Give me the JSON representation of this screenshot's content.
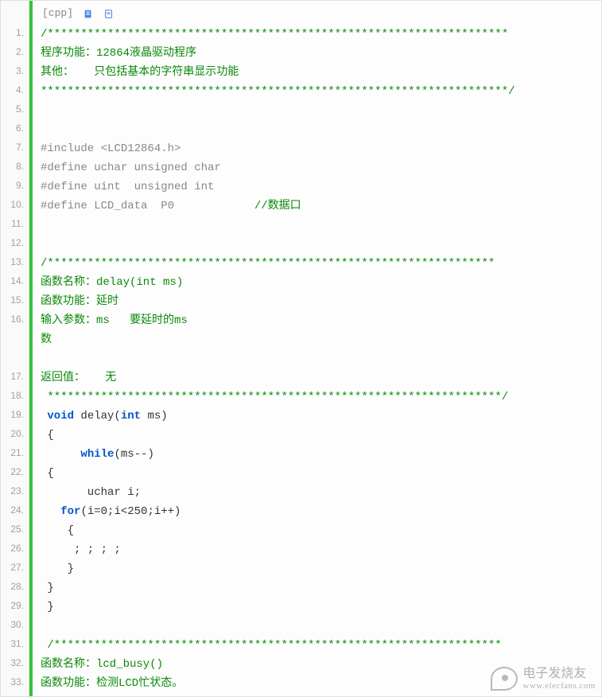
{
  "toolbar": {
    "lang": "[cpp]",
    "icons": [
      "copy-icon",
      "view-icon"
    ]
  },
  "lines": [
    {
      "n": "1.",
      "fragments": [
        {
          "cls": "comment",
          "t": "/*********************************************************************"
        }
      ]
    },
    {
      "n": "2.",
      "fragments": [
        {
          "cls": "comment",
          "t": "程序功能：12864液晶驱动程序"
        }
      ]
    },
    {
      "n": "3.",
      "fragments": [
        {
          "cls": "comment",
          "t": "其他：   只包括基本的字符串显示功能"
        }
      ]
    },
    {
      "n": "4.",
      "fragments": [
        {
          "cls": "comment",
          "t": "**********************************************************************/"
        }
      ]
    },
    {
      "n": "5.",
      "fragments": [
        {
          "cls": "plain",
          "t": " "
        }
      ]
    },
    {
      "n": "6.",
      "fragments": [
        {
          "cls": "plain",
          "t": " "
        }
      ]
    },
    {
      "n": "7.",
      "fragments": [
        {
          "cls": "preproc",
          "t": "#include <LCD12864.h>"
        }
      ]
    },
    {
      "n": "8.",
      "fragments": [
        {
          "cls": "preproc",
          "t": "#define uchar unsigned char"
        }
      ]
    },
    {
      "n": "9.",
      "fragments": [
        {
          "cls": "preproc",
          "t": "#define uint  unsigned int"
        }
      ]
    },
    {
      "n": "10.",
      "fragments": [
        {
          "cls": "preproc",
          "t": "#define LCD_data  P0            "
        },
        {
          "cls": "comment",
          "t": "//数据口"
        }
      ]
    },
    {
      "n": "11.",
      "fragments": [
        {
          "cls": "plain",
          "t": " "
        }
      ]
    },
    {
      "n": "12.",
      "fragments": [
        {
          "cls": "plain",
          "t": " "
        }
      ]
    },
    {
      "n": "13.",
      "fragments": [
        {
          "cls": "comment",
          "t": "/*******************************************************************"
        }
      ]
    },
    {
      "n": "14.",
      "fragments": [
        {
          "cls": "comment",
          "t": "函数名称：delay(int ms)"
        }
      ]
    },
    {
      "n": "15.",
      "fragments": [
        {
          "cls": "comment",
          "t": "函数功能：延时"
        }
      ]
    },
    {
      "n": "16.",
      "tall": true,
      "fragments": [
        {
          "cls": "comment",
          "t": "输入参数：ms   要延时的ms\n数"
        }
      ]
    },
    {
      "n": "",
      "fragments": [
        {
          "cls": "plain",
          "t": " "
        }
      ]
    },
    {
      "n": "17.",
      "fragments": [
        {
          "cls": "comment",
          "t": "返回值：   无"
        }
      ]
    },
    {
      "n": "18.",
      "fragments": [
        {
          "cls": "comment",
          "t": " ********************************************************************/"
        }
      ]
    },
    {
      "n": "19.",
      "fragments": [
        {
          "cls": "plain",
          "t": " "
        },
        {
          "cls": "keyword",
          "t": "void"
        },
        {
          "cls": "plain",
          "t": " delay("
        },
        {
          "cls": "keyword",
          "t": "int"
        },
        {
          "cls": "plain",
          "t": " ms)"
        }
      ]
    },
    {
      "n": "20.",
      "fragments": [
        {
          "cls": "plain",
          "t": " {"
        }
      ]
    },
    {
      "n": "21.",
      "fragments": [
        {
          "cls": "plain",
          "t": "      "
        },
        {
          "cls": "keyword",
          "t": "while"
        },
        {
          "cls": "plain",
          "t": "(ms--)"
        }
      ]
    },
    {
      "n": "22.",
      "fragments": [
        {
          "cls": "plain",
          "t": " {"
        }
      ]
    },
    {
      "n": "23.",
      "fragments": [
        {
          "cls": "plain",
          "t": "       uchar i;"
        }
      ]
    },
    {
      "n": "24.",
      "fragments": [
        {
          "cls": "plain",
          "t": "   "
        },
        {
          "cls": "keyword",
          "t": "for"
        },
        {
          "cls": "plain",
          "t": "(i=0;i<250;i++)"
        }
      ]
    },
    {
      "n": "25.",
      "fragments": [
        {
          "cls": "plain",
          "t": "    {"
        }
      ]
    },
    {
      "n": "26.",
      "fragments": [
        {
          "cls": "plain",
          "t": "     ; ; ; ;"
        }
      ]
    },
    {
      "n": "27.",
      "fragments": [
        {
          "cls": "plain",
          "t": "    }"
        }
      ]
    },
    {
      "n": "28.",
      "fragments": [
        {
          "cls": "plain",
          "t": " }"
        }
      ]
    },
    {
      "n": "29.",
      "fragments": [
        {
          "cls": "plain",
          "t": " }"
        }
      ]
    },
    {
      "n": "30.",
      "fragments": [
        {
          "cls": "plain",
          "t": " "
        }
      ]
    },
    {
      "n": "31.",
      "fragments": [
        {
          "cls": "comment",
          "t": " /*******************************************************************"
        }
      ]
    },
    {
      "n": "32.",
      "fragments": [
        {
          "cls": "comment",
          "t": "函数名称：lcd_busy()"
        }
      ]
    },
    {
      "n": "33.",
      "fragments": [
        {
          "cls": "comment",
          "t": "函数功能：检测LCD忙状态。"
        }
      ]
    }
  ],
  "watermark": {
    "title": "电子发烧友",
    "sub": "www.elecfans.com"
  }
}
